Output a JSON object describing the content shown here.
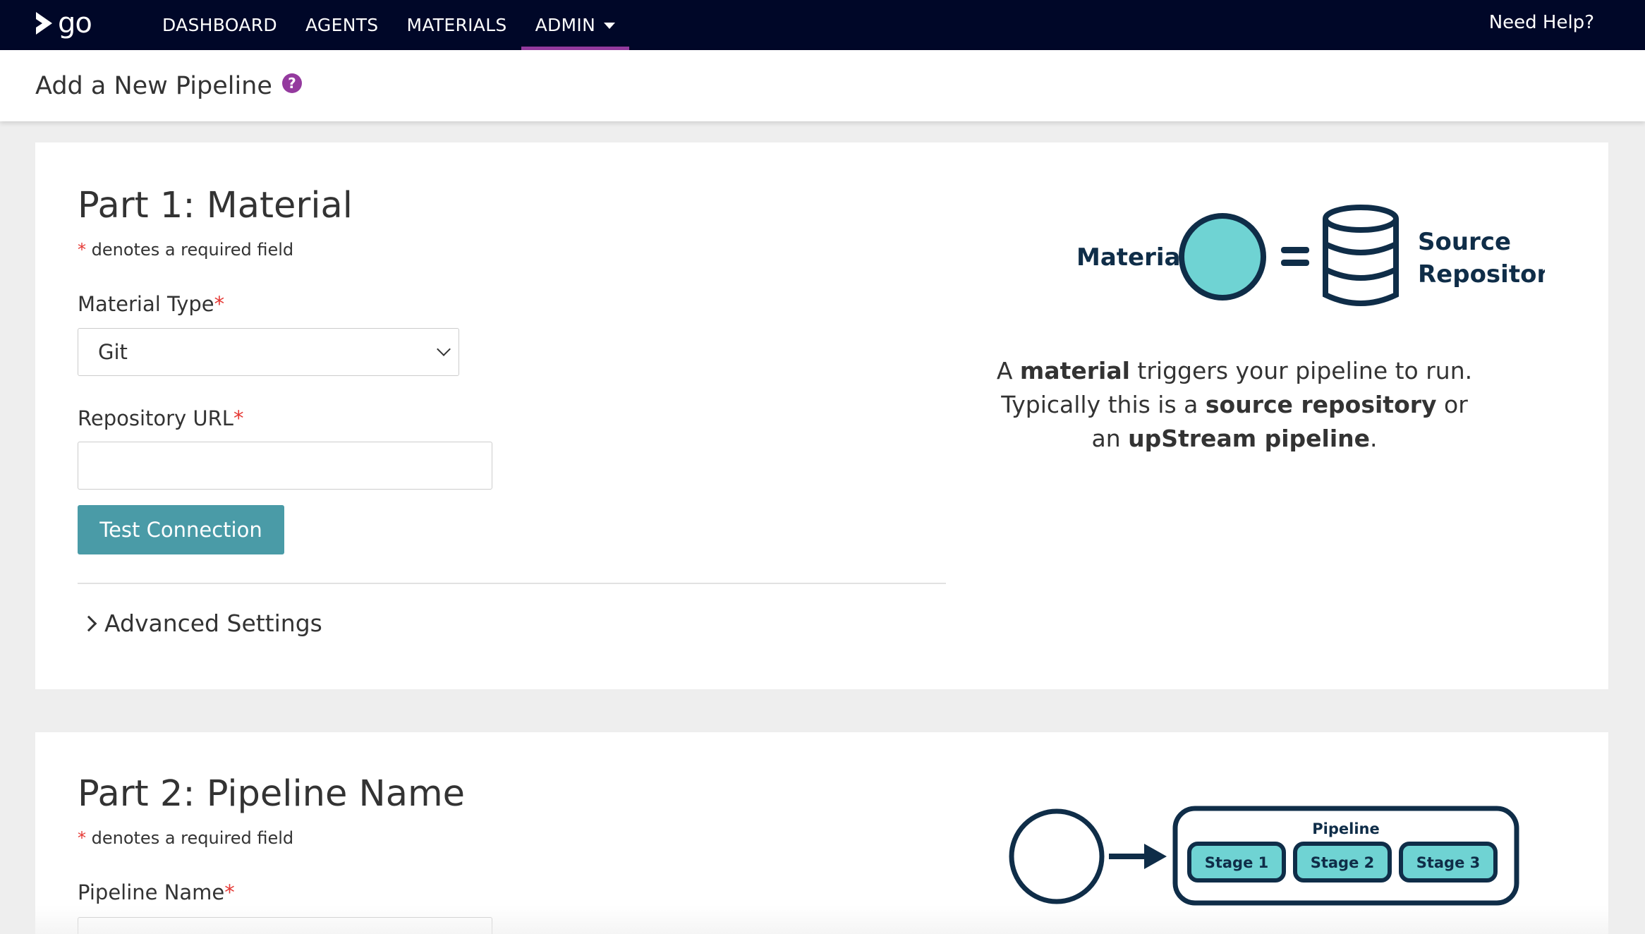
{
  "nav": {
    "logo_text": "go",
    "items": [
      {
        "label": "DASHBOARD"
      },
      {
        "label": "AGENTS"
      },
      {
        "label": "MATERIALS"
      },
      {
        "label": "ADMIN",
        "active": true
      }
    ],
    "help_label": "Need Help?",
    "active_color": "#943a9e",
    "background": "#000728"
  },
  "header": {
    "title": "Add a New Pipeline",
    "help_icon": "question-circle-icon"
  },
  "part1": {
    "title": "Part 1: Material",
    "required_note_star": "*",
    "required_note": " denotes a required field",
    "material_type_label": "Material Type",
    "material_type_value": "Git",
    "repo_url_label": "Repository URL",
    "repo_url_value": "",
    "test_button": "Test Connection",
    "advanced_label": "Advanced Settings",
    "illustration": {
      "material_label": "Material",
      "source_label_1": "Source",
      "source_label_2": "Repository"
    },
    "description": {
      "line1_pre": "A ",
      "line1_bold": "material",
      "line1_post": " triggers your pipeline to run.",
      "line2_pre": "Typically this is a ",
      "line2_bold": "source repository",
      "line2_post": " or",
      "line3_pre": "an ",
      "line3_bold": "upStream pipeline",
      "line3_post": "."
    }
  },
  "part2": {
    "title": "Part 2: Pipeline Name",
    "required_note_star": "*",
    "required_note": " denotes a required field",
    "pipeline_name_label": "Pipeline Name",
    "illustration": {
      "pipeline_label": "Pipeline",
      "stages": [
        "Stage 1",
        "Stage 2",
        "Stage 3"
      ]
    }
  },
  "colors": {
    "accent_teal": "#6fd3d3",
    "button": "#4a9ba7",
    "dark_navy": "#0f2d48",
    "required": "#e53935"
  }
}
